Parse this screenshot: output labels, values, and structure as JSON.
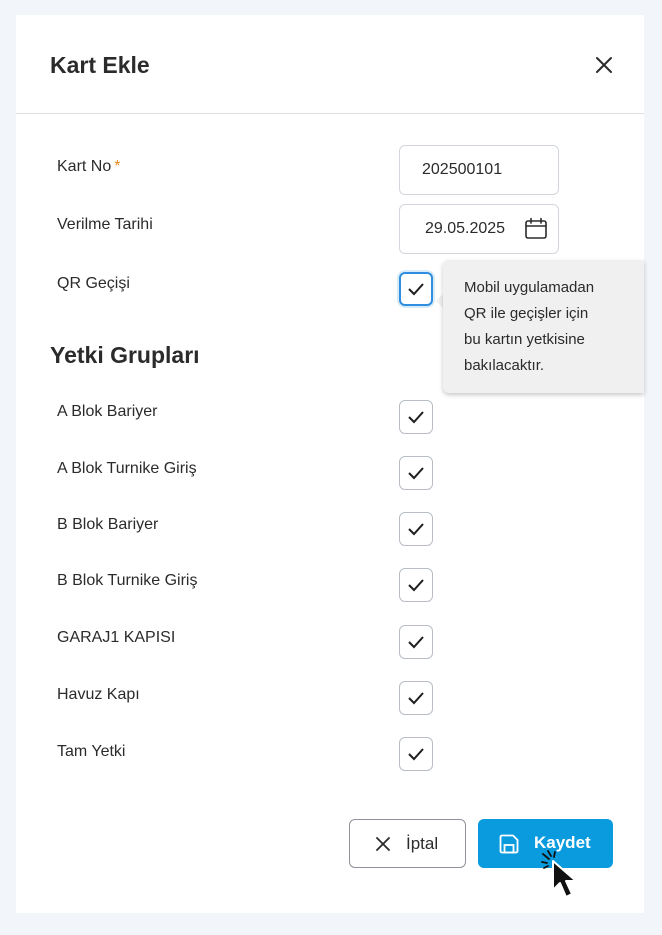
{
  "dialog": {
    "title": "Kart Ekle",
    "close_icon": "close-icon"
  },
  "form": {
    "card_no": {
      "label": "Kart No",
      "required_mark": "*",
      "value": "202500101"
    },
    "issue_date": {
      "label": "Verilme Tarihi",
      "value": "29.05.2025",
      "icon": "calendar-icon"
    },
    "qr_pass": {
      "label": "QR Geçişi",
      "checked": true,
      "tooltip": [
        "Mobil uygulamadan",
        "QR ile geçişler için",
        "bu kartın yetkisine",
        "bakılacaktır."
      ]
    }
  },
  "permission_groups": {
    "title": "Yetki Grupları",
    "items": [
      {
        "label": "A Blok Bariyer",
        "checked": true
      },
      {
        "label": "A Blok Turnike Giriş",
        "checked": true
      },
      {
        "label": "B Blok Bariyer",
        "checked": true
      },
      {
        "label": "B Blok Turnike Giriş",
        "checked": true
      },
      {
        "label": "GARAJ1 KAPISI",
        "checked": true
      },
      {
        "label": "Havuz Kapı",
        "checked": true
      },
      {
        "label": "Tam Yetki",
        "checked": true
      }
    ]
  },
  "footer": {
    "cancel_label": "İptal",
    "save_label": "Kaydet"
  },
  "colors": {
    "primary": "#0a9bdf",
    "required": "#e58a1f",
    "focus": "#2f8ee0"
  }
}
